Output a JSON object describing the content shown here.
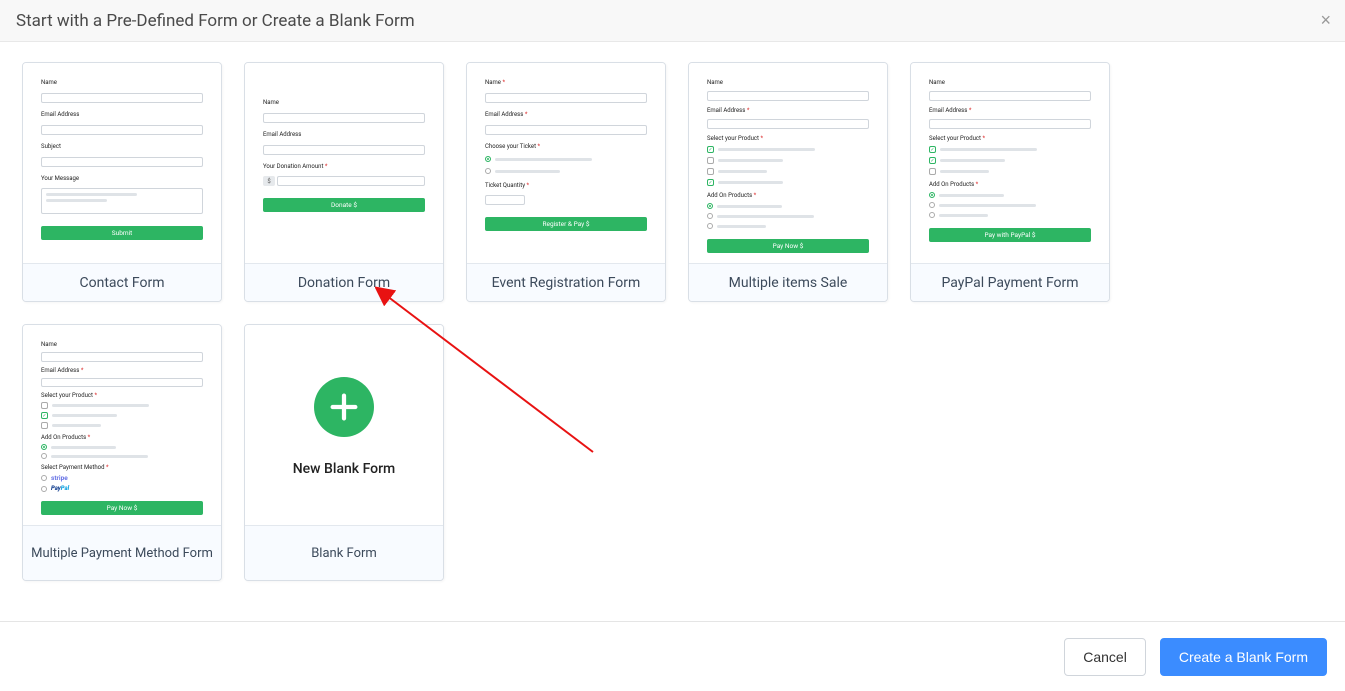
{
  "modal": {
    "title": "Start with a Pre-Defined Form or Create a Blank Form",
    "close_label": "×"
  },
  "cards": {
    "contact": {
      "title": "Contact Form",
      "fields": {
        "name": "Name",
        "email": "Email Address",
        "subject": "Subject",
        "message": "Your Message"
      },
      "button": "Submit"
    },
    "donation": {
      "title": "Donation Form",
      "fields": {
        "name": "Name",
        "email": "Email Address",
        "amount": "Your Donation Amount"
      },
      "button": "Donate $"
    },
    "event": {
      "title": "Event Registration Form",
      "fields": {
        "name": "Name",
        "email": "Email Address",
        "ticket": "Choose your Ticket",
        "qty": "Ticket Quantity"
      },
      "button": "Register & Pay $"
    },
    "multiitem": {
      "title": "Multiple items Sale",
      "fields": {
        "name": "Name",
        "email": "Email Address",
        "product": "Select your Product",
        "addon": "Add On Products"
      },
      "button": "Pay Now $"
    },
    "paypal": {
      "title": "PayPal Payment Form",
      "fields": {
        "name": "Name",
        "email": "Email Address",
        "product": "Select your Product",
        "addon": "Add On Products"
      },
      "button": "Pay with PayPal $"
    },
    "multipay": {
      "title": "Multiple Payment Method Form",
      "fields": {
        "name": "Name",
        "email": "Email Address",
        "product": "Select your Product",
        "addon": "Add On Products",
        "method": "Select Payment Method"
      },
      "stripe_label": "stripe",
      "paypal_label_1": "Pay",
      "paypal_label_2": "Pal",
      "button": "Pay Now $"
    },
    "blank": {
      "title": "Blank Form",
      "new_label": "New Blank Form"
    }
  },
  "footer": {
    "cancel": "Cancel",
    "create": "Create a Blank Form"
  }
}
